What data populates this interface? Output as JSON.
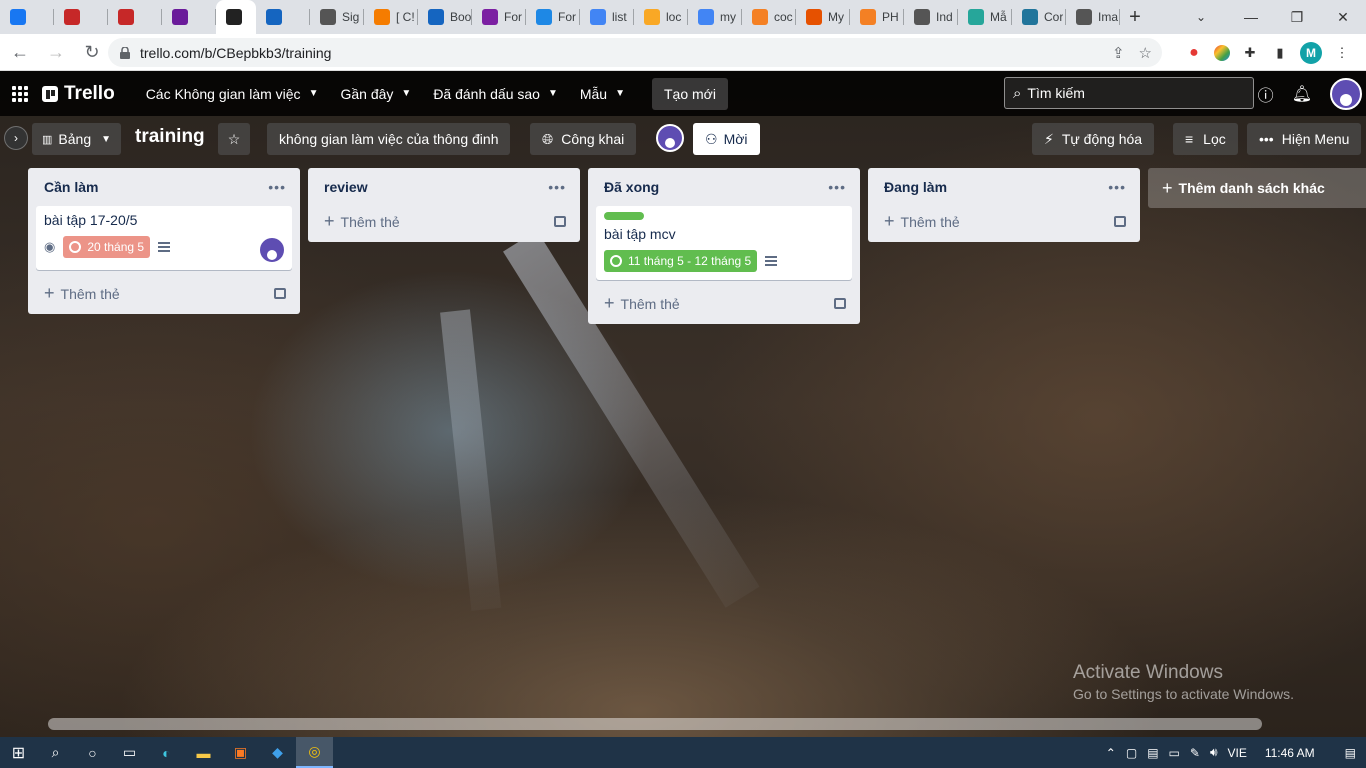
{
  "browser": {
    "tabs": [
      {
        "icon": "facebook-icon",
        "label": "",
        "color": "#1877f2"
      },
      {
        "icon": "news-icon",
        "label": "",
        "color": "#c62828"
      },
      {
        "icon": "red-arrow-icon",
        "label": "",
        "color": "#c62828"
      },
      {
        "icon": "at-icon",
        "label": "",
        "color": "#6a1b9a"
      },
      {
        "icon": "trello-icon",
        "label": "",
        "color": "#222222",
        "active": true
      },
      {
        "icon": "v-icon",
        "label": "",
        "color": "#1565c0"
      },
      {
        "icon": "globe-icon",
        "label": "Sig",
        "color": "#555555"
      },
      {
        "icon": "blogger-icon",
        "label": "[ C!",
        "color": "#f57c00"
      },
      {
        "icon": "box-icon",
        "label": "Boo",
        "color": "#1565c0"
      },
      {
        "icon": "b-icon",
        "label": "For",
        "color": "#7b1fa2"
      },
      {
        "icon": "flag-icon",
        "label": "For",
        "color": "#1e88e5"
      },
      {
        "icon": "google-icon",
        "label": "list",
        "color": "#4285f4"
      },
      {
        "icon": "php-icon",
        "label": "loc",
        "color": "#f9a825"
      },
      {
        "icon": "google-icon",
        "label": "my",
        "color": "#4285f4"
      },
      {
        "icon": "stack-icon",
        "label": "coc",
        "color": "#f48024"
      },
      {
        "icon": "m-icon",
        "label": "My",
        "color": "#e65100"
      },
      {
        "icon": "stack-icon",
        "label": "PH",
        "color": "#f48024"
      },
      {
        "icon": "globe-icon",
        "label": "Ind",
        "color": "#555555"
      },
      {
        "icon": "diamond-icon",
        "label": "Mẫ",
        "color": "#26a69a"
      },
      {
        "icon": "wordpress-icon",
        "label": "Cor",
        "color": "#21759b"
      },
      {
        "icon": "globe-icon",
        "label": "Ima",
        "color": "#555555"
      }
    ],
    "url": "trello.com/b/CBepbkb3/training",
    "profile_initial": "M"
  },
  "header": {
    "logo": "Trello",
    "menu": [
      {
        "label": "Các Không gian làm việc"
      },
      {
        "label": "Gần đây"
      },
      {
        "label": "Đã đánh dấu sao"
      },
      {
        "label": "Mẫu"
      }
    ],
    "create_label": "Tạo mới",
    "search_placeholder": "Tìm kiếm"
  },
  "board": {
    "view_label": "Bảng",
    "title": "training",
    "workspace_label": "không gian làm việc của thông đinh",
    "visibility_label": "Công khai",
    "invite_label": "Mời",
    "automation_label": "Tự động hóa",
    "filter_label": "Lọc",
    "show_menu_label": "Hiện Menu",
    "add_list_label": "Thêm danh sách khác",
    "lists": [
      {
        "title": "Cần làm",
        "add_card_label": "Thêm thẻ",
        "cards": [
          {
            "title": "bài tập 17-20/5",
            "due": "20 tháng 5",
            "due_status": "overdue",
            "watching": true,
            "has_description": true,
            "has_member": true
          }
        ]
      },
      {
        "title": "review",
        "add_card_label": "Thêm thẻ",
        "cards": []
      },
      {
        "title": "Đã xong",
        "add_card_label": "Thêm thẻ",
        "cards": [
          {
            "title": "bài tập mcv",
            "label_color": "#61bd4f",
            "due": "11 tháng 5 - 12 tháng 5",
            "due_status": "complete",
            "has_description": true
          }
        ]
      },
      {
        "title": "Đang làm",
        "add_card_label": "Thêm thẻ",
        "cards": []
      }
    ]
  },
  "watermark": {
    "line1": "Activate Windows",
    "line2": "Go to Settings to activate Windows."
  },
  "taskbar": {
    "language": "VIE",
    "time": "11:46 AM"
  }
}
